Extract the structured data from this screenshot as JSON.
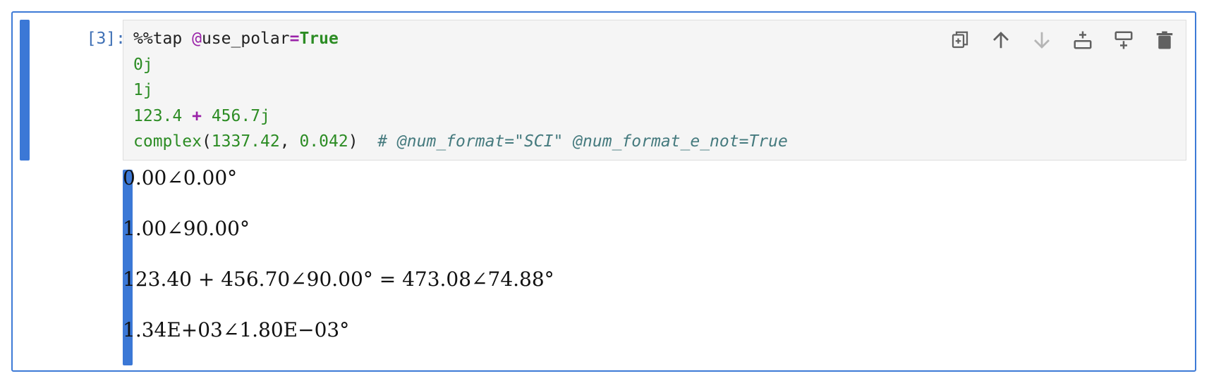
{
  "cell": {
    "prompt": "[3]:",
    "code": {
      "line1": {
        "magic": "%%tap ",
        "decorator": "@",
        "param": "use_polar",
        "eq": "=",
        "value": "True"
      },
      "line2": "0j",
      "line3": "1j",
      "line4": {
        "a": "123.4",
        "op": "+",
        "b": "456.7j"
      },
      "line5": {
        "fn": "complex",
        "open": "(",
        "arg1": "1337.42",
        "sep": ", ",
        "arg2": "0.042",
        "close": ")",
        "comment": "# @num_format=\"SCI\" @num_format_e_not=True"
      }
    },
    "toolbar": {
      "duplicate_icon": "duplicate-icon",
      "move_up_icon": "arrow-up-icon",
      "move_down_icon": "arrow-down-icon",
      "insert_above_icon": "insert-above-icon",
      "insert_below_icon": "insert-below-icon",
      "delete_icon": "trash-icon"
    },
    "outputs": [
      "0.00∠0.00°",
      "1.00∠90.00°",
      "123.40 + 456.70∠90.00° = 473.08∠74.88°",
      "1.34E+03∠1.80E−03°"
    ],
    "colors": {
      "accent": "#3d7ad6",
      "collapser": "#3b78d6",
      "prompt": "#3f70b5",
      "keyword": "#2c8c24",
      "decorator": "#9a22a8",
      "comment": "#457a7e"
    }
  }
}
